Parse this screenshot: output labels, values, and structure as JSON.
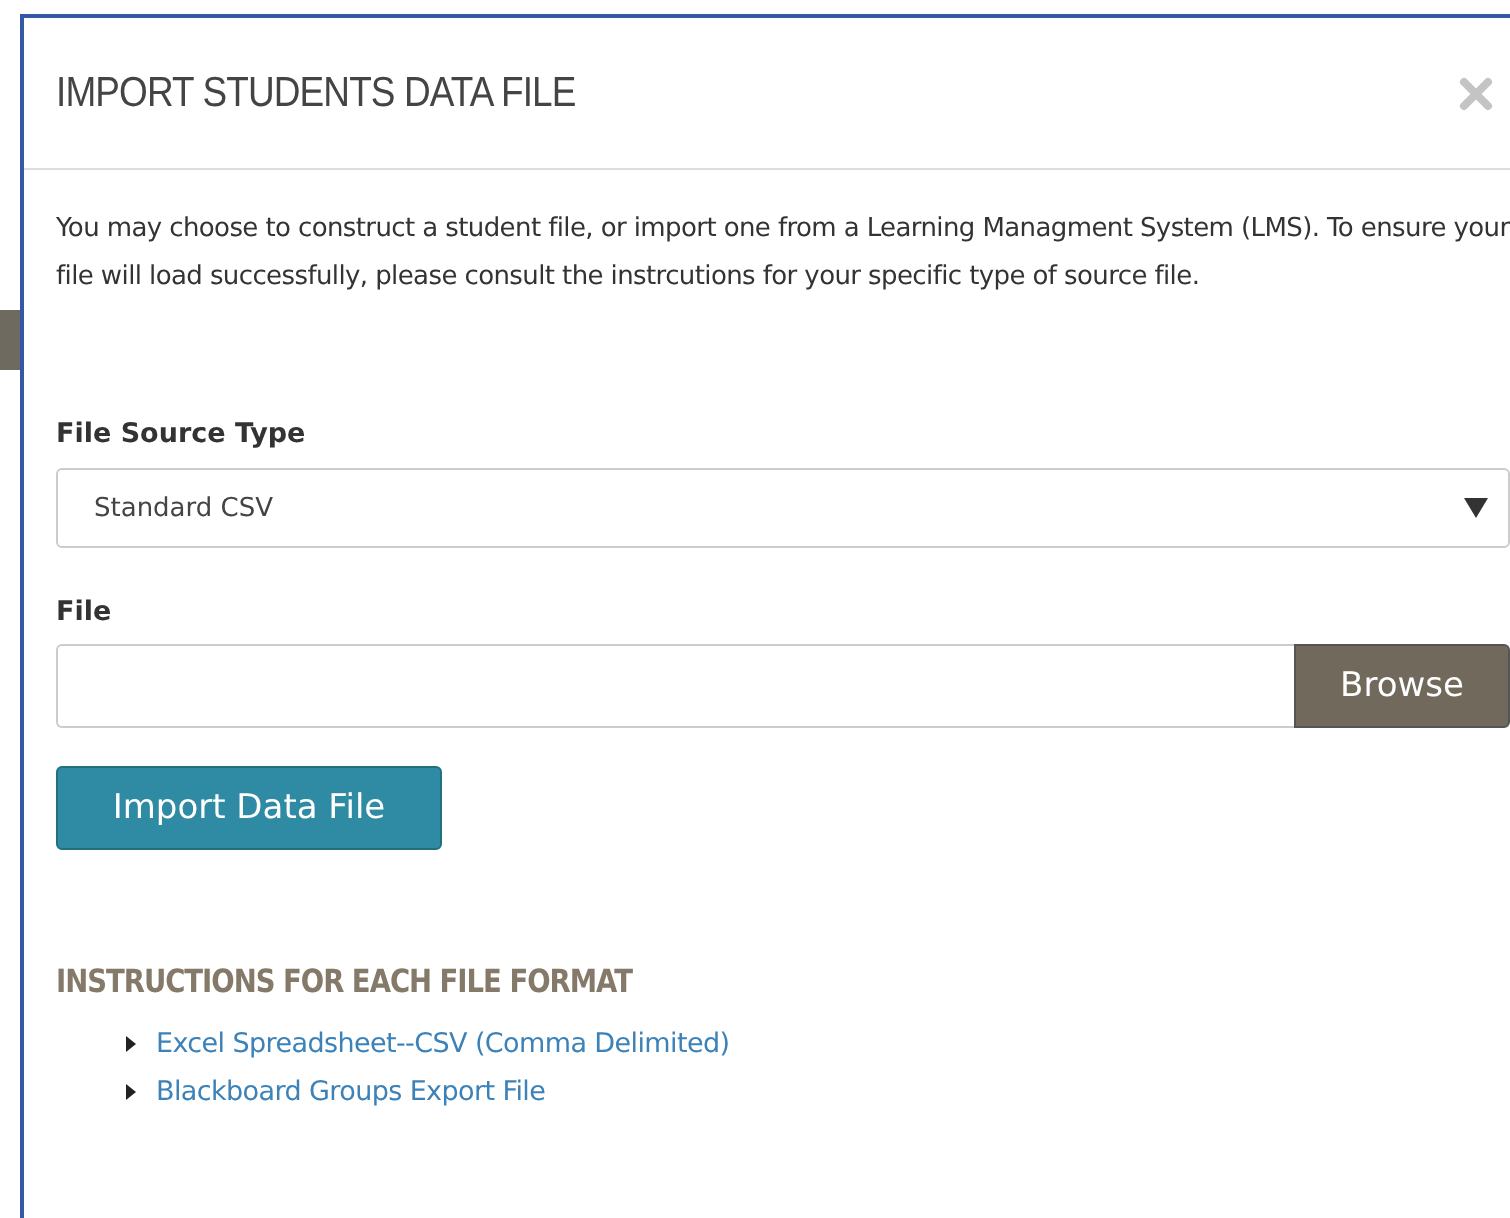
{
  "dialog": {
    "title": "IMPORT STUDENTS DATA FILE",
    "intro": "You may choose to construct a student file, or import one from a Learning Managment System (LMS). To ensure your file will load successfully, please consult the instrcutions for your specific type of source file.",
    "source_type": {
      "label": "File Source Type",
      "value": "Standard CSV"
    },
    "file": {
      "label": "File",
      "browse": "Browse"
    },
    "import_button": "Import Data File",
    "instructions": {
      "heading": "INSTRUCTIONS FOR EACH FILE FORMAT",
      "links": [
        "Excel Spreadsheet--CSV (Comma Delimited)",
        "Blackboard Groups Export File"
      ]
    }
  }
}
